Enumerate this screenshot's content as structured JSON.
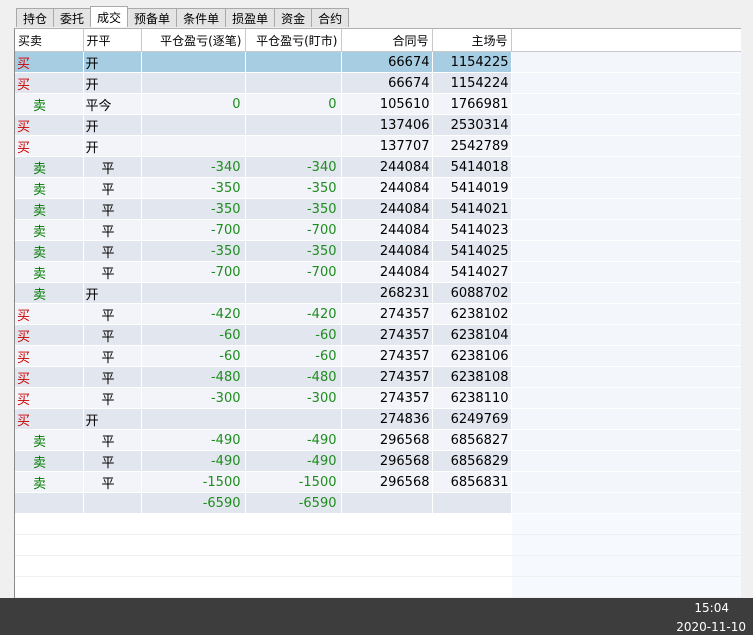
{
  "tabs": [
    "持仓",
    "委托",
    "成交",
    "预备单",
    "条件单",
    "损盈单",
    "资金",
    "合约"
  ],
  "active_tab": 2,
  "columns": [
    "买卖",
    "开平",
    "平仓盈亏(逐笔)",
    "平仓盈亏(盯市)",
    "合同号",
    "主场号"
  ],
  "rows": [
    {
      "side": "买",
      "oc": "开",
      "pnl1": "",
      "pnl2": "",
      "contract": "66674",
      "main": "1154225",
      "selected": true
    },
    {
      "side": "买",
      "oc": "开",
      "pnl1": "",
      "pnl2": "",
      "contract": "66674",
      "main": "1154224"
    },
    {
      "side": "卖",
      "oc": "平今",
      "pnl1": "0",
      "pnl2": "0",
      "contract": "105610",
      "main": "1766981"
    },
    {
      "side": "买",
      "oc": "开",
      "pnl1": "",
      "pnl2": "",
      "contract": "137406",
      "main": "2530314"
    },
    {
      "side": "买",
      "oc": "开",
      "pnl1": "",
      "pnl2": "",
      "contract": "137707",
      "main": "2542789"
    },
    {
      "side": "卖",
      "oc": "平",
      "pnl1": "-340",
      "pnl2": "-340",
      "contract": "244084",
      "main": "5414018"
    },
    {
      "side": "卖",
      "oc": "平",
      "pnl1": "-350",
      "pnl2": "-350",
      "contract": "244084",
      "main": "5414019"
    },
    {
      "side": "卖",
      "oc": "平",
      "pnl1": "-350",
      "pnl2": "-350",
      "contract": "244084",
      "main": "5414021"
    },
    {
      "side": "卖",
      "oc": "平",
      "pnl1": "-700",
      "pnl2": "-700",
      "contract": "244084",
      "main": "5414023"
    },
    {
      "side": "卖",
      "oc": "平",
      "pnl1": "-350",
      "pnl2": "-350",
      "contract": "244084",
      "main": "5414025"
    },
    {
      "side": "卖",
      "oc": "平",
      "pnl1": "-700",
      "pnl2": "-700",
      "contract": "244084",
      "main": "5414027"
    },
    {
      "side": "卖",
      "oc": "开",
      "pnl1": "",
      "pnl2": "",
      "contract": "268231",
      "main": "6088702"
    },
    {
      "side": "买",
      "oc": "平",
      "pnl1": "-420",
      "pnl2": "-420",
      "contract": "274357",
      "main": "6238102"
    },
    {
      "side": "买",
      "oc": "平",
      "pnl1": "-60",
      "pnl2": "-60",
      "contract": "274357",
      "main": "6238104"
    },
    {
      "side": "买",
      "oc": "平",
      "pnl1": "-60",
      "pnl2": "-60",
      "contract": "274357",
      "main": "6238106"
    },
    {
      "side": "买",
      "oc": "平",
      "pnl1": "-480",
      "pnl2": "-480",
      "contract": "274357",
      "main": "6238108"
    },
    {
      "side": "买",
      "oc": "平",
      "pnl1": "-300",
      "pnl2": "-300",
      "contract": "274357",
      "main": "6238110"
    },
    {
      "side": "买",
      "oc": "开",
      "pnl1": "",
      "pnl2": "",
      "contract": "274836",
      "main": "6249769"
    },
    {
      "side": "卖",
      "oc": "平",
      "pnl1": "-490",
      "pnl2": "-490",
      "contract": "296568",
      "main": "6856827"
    },
    {
      "side": "卖",
      "oc": "平",
      "pnl1": "-490",
      "pnl2": "-490",
      "contract": "296568",
      "main": "6856829"
    },
    {
      "side": "卖",
      "oc": "平",
      "pnl1": "-1500",
      "pnl2": "-1500",
      "contract": "296568",
      "main": "6856831"
    }
  ],
  "total": {
    "pnl1": "-6590",
    "pnl2": "-6590"
  },
  "taskbar": {
    "time": "15:04",
    "date": "2020-11-10"
  },
  "colors": {
    "buy": "#cc0000",
    "sell": "#007a00",
    "pnl": "#1e8c1e",
    "selected_row": "#a7cde2"
  }
}
